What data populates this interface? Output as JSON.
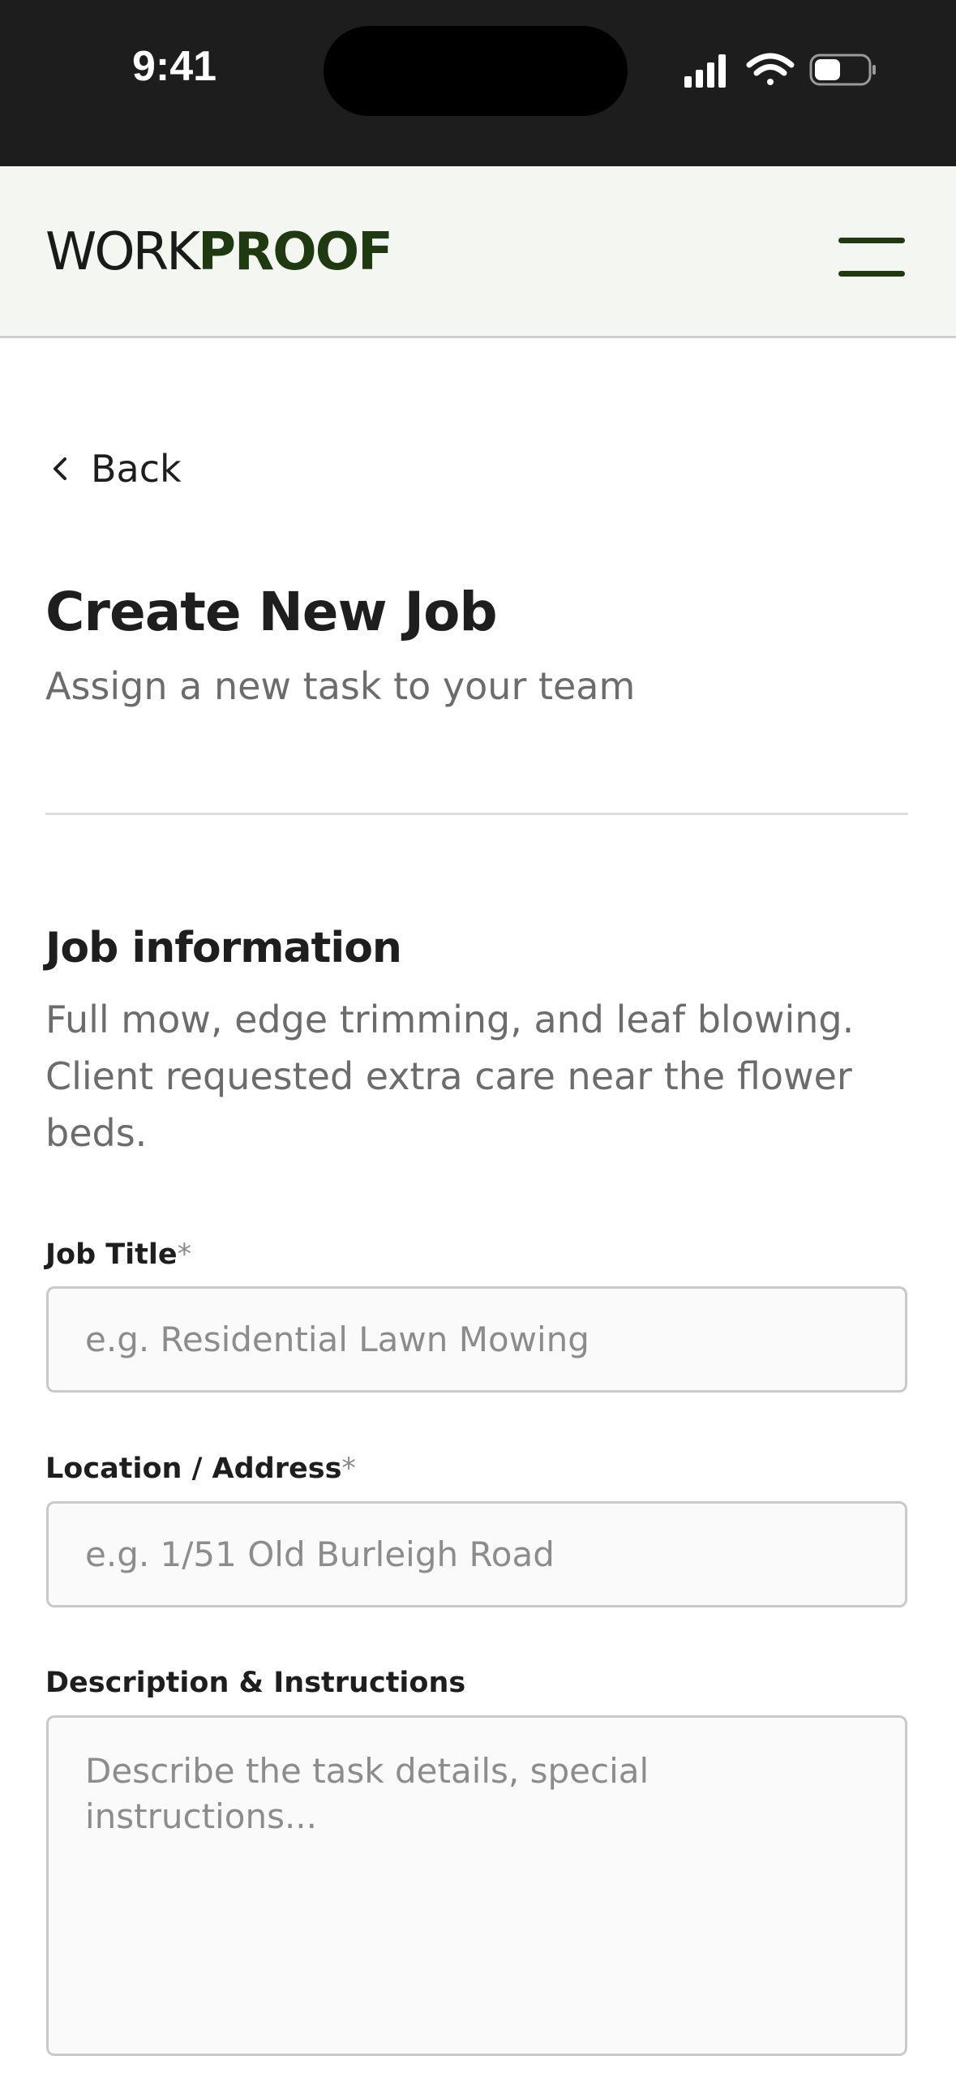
{
  "status_bar": {
    "time": "9:41"
  },
  "header": {
    "logo_light": "WORK",
    "logo_bold": "PROOF",
    "brand_color": "#1f3a10"
  },
  "nav": {
    "back_label": "Back"
  },
  "page": {
    "title": "Create New Job",
    "subtitle": "Assign a new task to your team"
  },
  "section": {
    "title": "Job information",
    "description": "Full mow, edge trimming, and leaf blowing. Client requested extra care near the flower beds."
  },
  "form": {
    "job_title": {
      "label": "Job Title",
      "required_mark": "*",
      "value": "",
      "placeholder": "e.g. Residential Lawn Mowing"
    },
    "location": {
      "label": "Location / Address",
      "required_mark": "*",
      "value": "",
      "placeholder": "e.g. 1/51 Old Burleigh Road"
    },
    "description": {
      "label": "Description & Instructions",
      "value": "",
      "placeholder": "Describe the task details, special instructions..."
    }
  },
  "icons": {
    "menu": "hamburger-menu-icon",
    "back": "chevron-left-icon",
    "signal": "cellular-signal-icon",
    "wifi": "wifi-icon",
    "battery": "battery-icon"
  }
}
